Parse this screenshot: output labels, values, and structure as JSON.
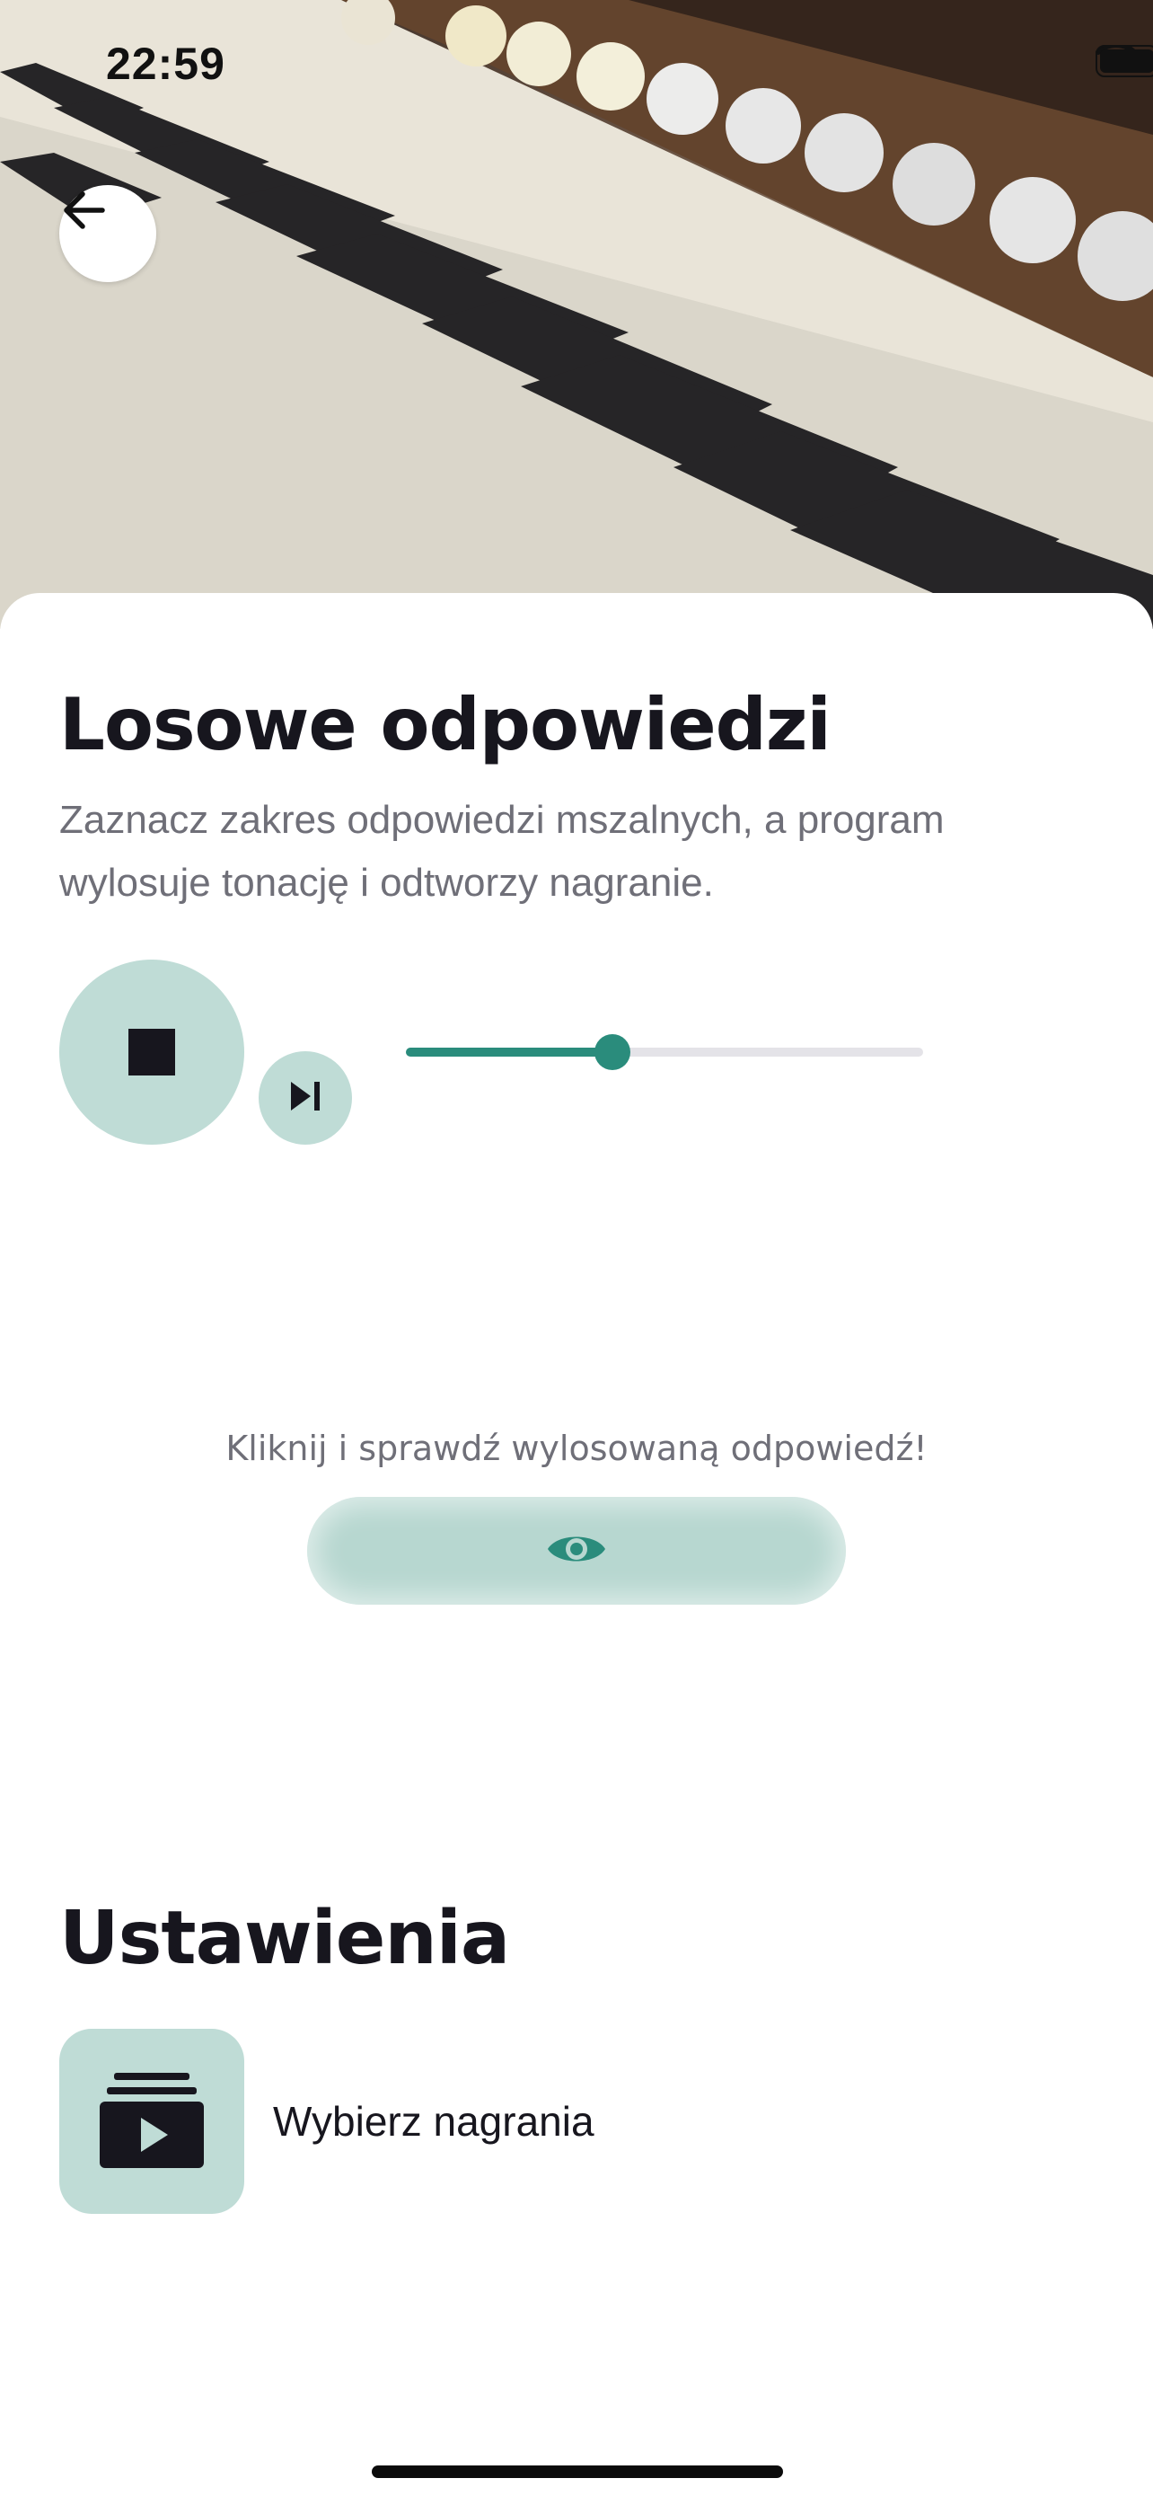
{
  "status_bar": {
    "time": "22:59",
    "wifi_icon": "wifi-icon",
    "battery_icon": "battery-icon"
  },
  "hero": {
    "image": "organ-keyboard-photo",
    "back_icon": "arrow-left-icon"
  },
  "content": {
    "title": "Losowe odpowiedzi",
    "subtitle": "Zaznacz zakres odpowiedzi mszalnych, a program wylosuje tonację i odtworzy nagranie."
  },
  "player": {
    "stop_icon": "stop-icon",
    "skip_icon": "skip-next-icon",
    "progress": 0.4
  },
  "reveal": {
    "caption": "Kliknij i sprawdź wylosowaną odpowiedź!",
    "icon": "eye-icon"
  },
  "settings": {
    "title": "Ustawienia",
    "items": [
      {
        "label": "Wybierz nagrania",
        "icon": "video-library-icon"
      }
    ]
  },
  "colors": {
    "accent": "#2a8c7c",
    "accent_light": "#bfdcd6",
    "text_primary": "#17161e",
    "text_secondary": "#6f6f78"
  }
}
